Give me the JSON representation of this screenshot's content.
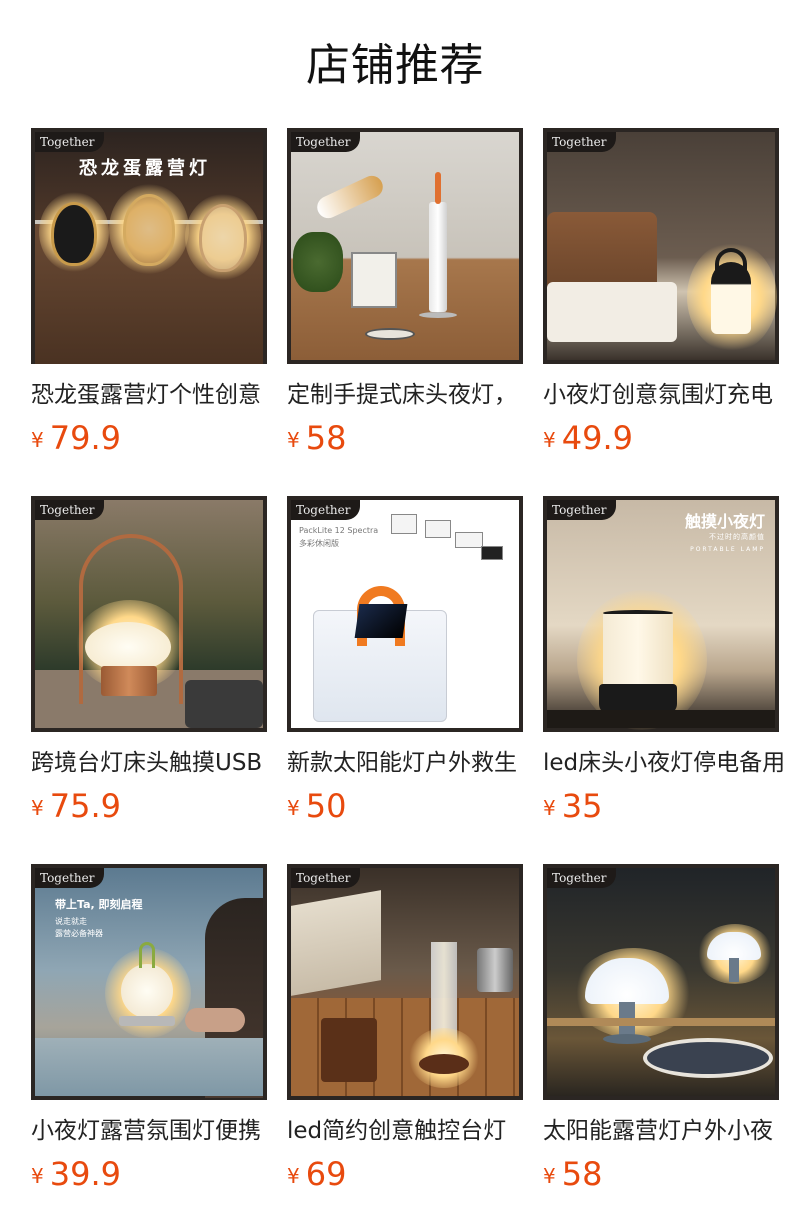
{
  "section_title": "店铺推荐",
  "brand_watermark": "Together",
  "currency_symbol": "¥",
  "products": [
    {
      "name": "恐龙蛋露营灯个性创意",
      "price": "79.9",
      "banner": "恐龙蛋露营灯",
      "icon": "camping-lantern-image"
    },
    {
      "name": "定制手提式床头夜灯，",
      "price": "58",
      "banner": "",
      "icon": "portable-night-light-image"
    },
    {
      "name": "小夜灯创意氛围灯充电",
      "price": "49.9",
      "banner": "",
      "icon": "bedside-lamp-image"
    },
    {
      "name": "跨境台灯床头触摸USB",
      "price": "75.9",
      "banner": "",
      "icon": "table-lamp-image"
    },
    {
      "name": "新款太阳能灯户外救生",
      "price": "50",
      "banner": "PackLite 12 Spectra",
      "banner_sub": "多彩休闲版",
      "icon": "solar-lantern-image"
    },
    {
      "name": "led床头小夜灯停电备用",
      "price": "35",
      "banner": "触摸小夜灯",
      "banner_sub": "不过时的高颜值",
      "banner_sub2": "PORTABLE LAMP",
      "icon": "touch-night-light-image"
    },
    {
      "name": "小夜灯露营氛围灯便携",
      "price": "39.9",
      "banner": "带上Ta, 即刻启程",
      "banner_sub": "说走就走",
      "banner_sub2": "露营必备神器",
      "icon": "beach-lantern-image"
    },
    {
      "name": "led简约创意触控台灯",
      "price": "69",
      "banner": "",
      "icon": "camp-table-lamp-image"
    },
    {
      "name": "太阳能露营灯户外小夜",
      "price": "58",
      "banner": "",
      "icon": "solar-mushroom-lamp-image"
    }
  ]
}
